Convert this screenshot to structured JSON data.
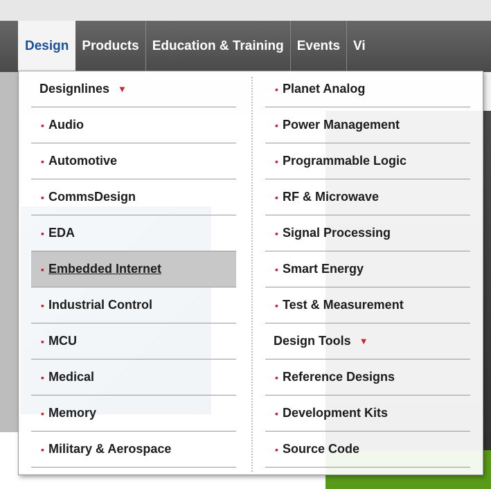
{
  "nav": {
    "tabs": [
      {
        "label": "Design"
      },
      {
        "label": "Products"
      },
      {
        "label": "Education & Training"
      },
      {
        "label": "Events"
      },
      {
        "label": "Vi"
      }
    ]
  },
  "dropdown": {
    "left_heading": "Designlines",
    "left_items": [
      "Audio",
      "Automotive",
      "CommsDesign",
      "EDA",
      "Embedded Internet",
      "Industrial Control",
      "MCU",
      "Medical",
      "Memory",
      "Military & Aerospace"
    ],
    "right_items_top": [
      "Planet Analog",
      "Power Management",
      "Programmable Logic",
      "RF & Microwave",
      "Signal Processing",
      "Smart Energy",
      "Test & Measurement"
    ],
    "right_heading": "Design Tools",
    "right_items_bottom": [
      "Reference Designs",
      "Development Kits",
      "Source Code"
    ]
  },
  "colors": {
    "accent": "#c0272d",
    "active_tab_text": "#1a4f9c",
    "nav_bg": "#555555"
  },
  "icons": {
    "heading_arrow": "triangle-down-icon",
    "bullet": "square-bullet-icon"
  }
}
